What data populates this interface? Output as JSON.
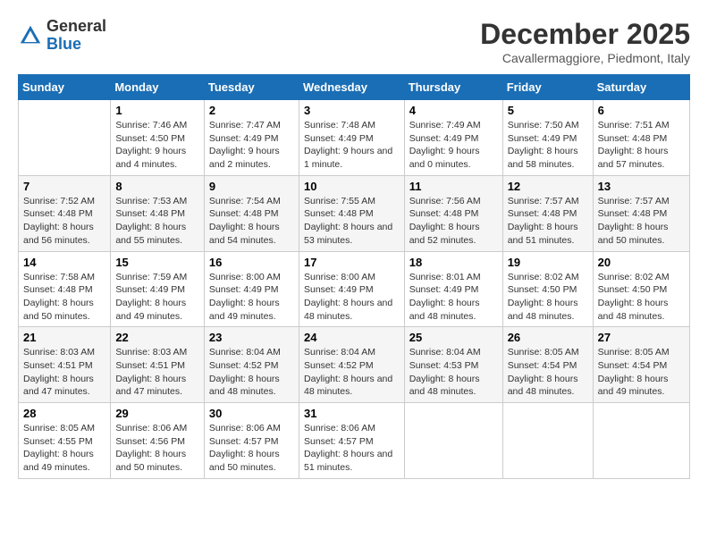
{
  "logo": {
    "general": "General",
    "blue": "Blue"
  },
  "title": "December 2025",
  "location": "Cavallermaggiore, Piedmont, Italy",
  "days_of_week": [
    "Sunday",
    "Monday",
    "Tuesday",
    "Wednesday",
    "Thursday",
    "Friday",
    "Saturday"
  ],
  "weeks": [
    [
      {
        "day": "",
        "sunrise": "",
        "sunset": "",
        "daylight": ""
      },
      {
        "day": "1",
        "sunrise": "Sunrise: 7:46 AM",
        "sunset": "Sunset: 4:50 PM",
        "daylight": "Daylight: 9 hours and 4 minutes."
      },
      {
        "day": "2",
        "sunrise": "Sunrise: 7:47 AM",
        "sunset": "Sunset: 4:49 PM",
        "daylight": "Daylight: 9 hours and 2 minutes."
      },
      {
        "day": "3",
        "sunrise": "Sunrise: 7:48 AM",
        "sunset": "Sunset: 4:49 PM",
        "daylight": "Daylight: 9 hours and 1 minute."
      },
      {
        "day": "4",
        "sunrise": "Sunrise: 7:49 AM",
        "sunset": "Sunset: 4:49 PM",
        "daylight": "Daylight: 9 hours and 0 minutes."
      },
      {
        "day": "5",
        "sunrise": "Sunrise: 7:50 AM",
        "sunset": "Sunset: 4:49 PM",
        "daylight": "Daylight: 8 hours and 58 minutes."
      },
      {
        "day": "6",
        "sunrise": "Sunrise: 7:51 AM",
        "sunset": "Sunset: 4:48 PM",
        "daylight": "Daylight: 8 hours and 57 minutes."
      }
    ],
    [
      {
        "day": "7",
        "sunrise": "Sunrise: 7:52 AM",
        "sunset": "Sunset: 4:48 PM",
        "daylight": "Daylight: 8 hours and 56 minutes."
      },
      {
        "day": "8",
        "sunrise": "Sunrise: 7:53 AM",
        "sunset": "Sunset: 4:48 PM",
        "daylight": "Daylight: 8 hours and 55 minutes."
      },
      {
        "day": "9",
        "sunrise": "Sunrise: 7:54 AM",
        "sunset": "Sunset: 4:48 PM",
        "daylight": "Daylight: 8 hours and 54 minutes."
      },
      {
        "day": "10",
        "sunrise": "Sunrise: 7:55 AM",
        "sunset": "Sunset: 4:48 PM",
        "daylight": "Daylight: 8 hours and 53 minutes."
      },
      {
        "day": "11",
        "sunrise": "Sunrise: 7:56 AM",
        "sunset": "Sunset: 4:48 PM",
        "daylight": "Daylight: 8 hours and 52 minutes."
      },
      {
        "day": "12",
        "sunrise": "Sunrise: 7:57 AM",
        "sunset": "Sunset: 4:48 PM",
        "daylight": "Daylight: 8 hours and 51 minutes."
      },
      {
        "day": "13",
        "sunrise": "Sunrise: 7:57 AM",
        "sunset": "Sunset: 4:48 PM",
        "daylight": "Daylight: 8 hours and 50 minutes."
      }
    ],
    [
      {
        "day": "14",
        "sunrise": "Sunrise: 7:58 AM",
        "sunset": "Sunset: 4:48 PM",
        "daylight": "Daylight: 8 hours and 50 minutes."
      },
      {
        "day": "15",
        "sunrise": "Sunrise: 7:59 AM",
        "sunset": "Sunset: 4:49 PM",
        "daylight": "Daylight: 8 hours and 49 minutes."
      },
      {
        "day": "16",
        "sunrise": "Sunrise: 8:00 AM",
        "sunset": "Sunset: 4:49 PM",
        "daylight": "Daylight: 8 hours and 49 minutes."
      },
      {
        "day": "17",
        "sunrise": "Sunrise: 8:00 AM",
        "sunset": "Sunset: 4:49 PM",
        "daylight": "Daylight: 8 hours and 48 minutes."
      },
      {
        "day": "18",
        "sunrise": "Sunrise: 8:01 AM",
        "sunset": "Sunset: 4:49 PM",
        "daylight": "Daylight: 8 hours and 48 minutes."
      },
      {
        "day": "19",
        "sunrise": "Sunrise: 8:02 AM",
        "sunset": "Sunset: 4:50 PM",
        "daylight": "Daylight: 8 hours and 48 minutes."
      },
      {
        "day": "20",
        "sunrise": "Sunrise: 8:02 AM",
        "sunset": "Sunset: 4:50 PM",
        "daylight": "Daylight: 8 hours and 48 minutes."
      }
    ],
    [
      {
        "day": "21",
        "sunrise": "Sunrise: 8:03 AM",
        "sunset": "Sunset: 4:51 PM",
        "daylight": "Daylight: 8 hours and 47 minutes."
      },
      {
        "day": "22",
        "sunrise": "Sunrise: 8:03 AM",
        "sunset": "Sunset: 4:51 PM",
        "daylight": "Daylight: 8 hours and 47 minutes."
      },
      {
        "day": "23",
        "sunrise": "Sunrise: 8:04 AM",
        "sunset": "Sunset: 4:52 PM",
        "daylight": "Daylight: 8 hours and 48 minutes."
      },
      {
        "day": "24",
        "sunrise": "Sunrise: 8:04 AM",
        "sunset": "Sunset: 4:52 PM",
        "daylight": "Daylight: 8 hours and 48 minutes."
      },
      {
        "day": "25",
        "sunrise": "Sunrise: 8:04 AM",
        "sunset": "Sunset: 4:53 PM",
        "daylight": "Daylight: 8 hours and 48 minutes."
      },
      {
        "day": "26",
        "sunrise": "Sunrise: 8:05 AM",
        "sunset": "Sunset: 4:54 PM",
        "daylight": "Daylight: 8 hours and 48 minutes."
      },
      {
        "day": "27",
        "sunrise": "Sunrise: 8:05 AM",
        "sunset": "Sunset: 4:54 PM",
        "daylight": "Daylight: 8 hours and 49 minutes."
      }
    ],
    [
      {
        "day": "28",
        "sunrise": "Sunrise: 8:05 AM",
        "sunset": "Sunset: 4:55 PM",
        "daylight": "Daylight: 8 hours and 49 minutes."
      },
      {
        "day": "29",
        "sunrise": "Sunrise: 8:06 AM",
        "sunset": "Sunset: 4:56 PM",
        "daylight": "Daylight: 8 hours and 50 minutes."
      },
      {
        "day": "30",
        "sunrise": "Sunrise: 8:06 AM",
        "sunset": "Sunset: 4:57 PM",
        "daylight": "Daylight: 8 hours and 50 minutes."
      },
      {
        "day": "31",
        "sunrise": "Sunrise: 8:06 AM",
        "sunset": "Sunset: 4:57 PM",
        "daylight": "Daylight: 8 hours and 51 minutes."
      },
      {
        "day": "",
        "sunrise": "",
        "sunset": "",
        "daylight": ""
      },
      {
        "day": "",
        "sunrise": "",
        "sunset": "",
        "daylight": ""
      },
      {
        "day": "",
        "sunrise": "",
        "sunset": "",
        "daylight": ""
      }
    ]
  ]
}
